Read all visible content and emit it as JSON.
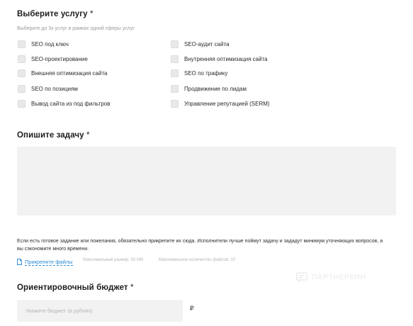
{
  "service": {
    "title": "Выберите услугу",
    "required_mark": "*",
    "hint": "Выберите до 3х услуг в рамках одной сферы услуг",
    "left_options": [
      "SEO под ключ",
      "SEO-проектирование",
      "Внешняя оптимизация сайта",
      "SEO по позициям",
      "Вывод сайта из под фильтров"
    ],
    "right_options": [
      "SEO-аудит сайта",
      "Внутренняя оптимизация сайта",
      "SEO по трафику",
      "Продвижение по лидам",
      "Управление репутацией (SERM)"
    ]
  },
  "task": {
    "title": "Опишите задачу",
    "required_mark": "*",
    "note": "Если есть готовое задание или пожелания, обязательно прикрепите их сюда. Исполнители лучше поймут задачу и зададут минимум уточняющих вопросов, а вы сэкономите много времени.",
    "attach_label": "Прикрепите файлы",
    "max_size": "Максимальный размер: 50 MB",
    "max_count": "Максимальное количество файлов: 10"
  },
  "budget": {
    "title": "Ориентировочный бюджет",
    "required_mark": "*",
    "placeholder": "Укажите бюджет (в рублях)",
    "currency": "₽"
  },
  "watermark": {
    "text": "ПАРТНЕРКИН",
    "icon": "partnerkin-logo-icon"
  }
}
